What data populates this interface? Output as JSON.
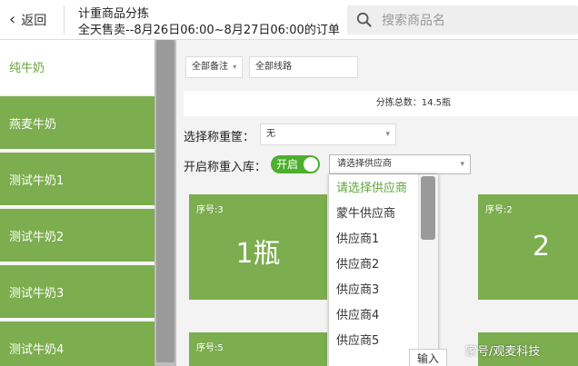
{
  "header": {
    "back_label": "返回",
    "title": "计重商品分拣",
    "subtitle": "全天售卖--8月26日06:00~8月27日06:00的订单",
    "search_placeholder": "搜索商品名"
  },
  "sidebar": {
    "items": [
      {
        "label": "纯牛奶",
        "active": true
      },
      {
        "label": "燕麦牛奶",
        "active": false
      },
      {
        "label": "测试牛奶1",
        "active": false
      },
      {
        "label": "测试牛奶2",
        "active": false
      },
      {
        "label": "测试牛奶3",
        "active": false
      },
      {
        "label": "测试牛奶4",
        "active": false
      }
    ]
  },
  "filters": {
    "remark": "全部备注",
    "route": "全部线路"
  },
  "summary": {
    "total_text": "分拣总数：14.5瓶"
  },
  "form": {
    "basket_label": "选择称重筐：",
    "basket_value": "无",
    "restock_label": "开启称重入库：",
    "toggle_text": "开启",
    "supplier_value": "请选择供应商"
  },
  "cards": [
    {
      "no": "序号:3",
      "qty": "1瓶"
    },
    {
      "no": "序号:2",
      "qty": "2"
    },
    {
      "no": "序号:5",
      "qty": ""
    }
  ],
  "dropdown": {
    "options": [
      "请选择供应商",
      "蒙牛供应商",
      "供应商1",
      "供应商2",
      "供应商3",
      "供应商4",
      "供应商5"
    ]
  },
  "input_button": "输入",
  "watermark": "家号/观麦科技",
  "colors": {
    "green": "#7cad4e",
    "toggle_green": "#4caf2e",
    "active_text": "#6aa43a"
  }
}
